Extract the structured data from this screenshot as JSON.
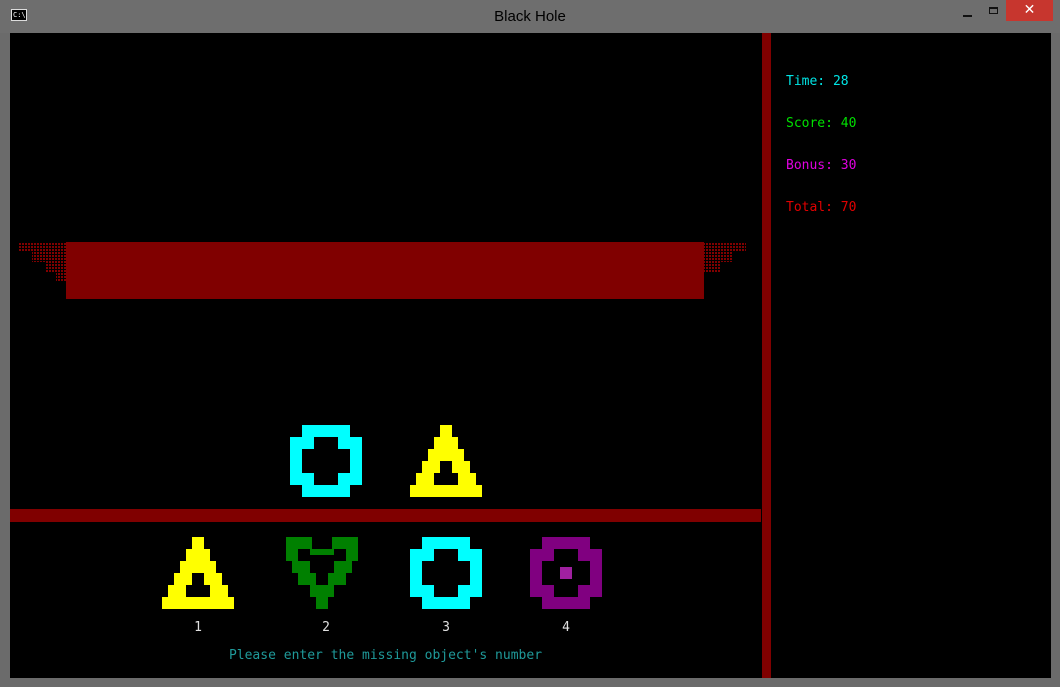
{
  "window": {
    "title": "Black Hole",
    "icon": "console-icon",
    "close_glyph": "✕"
  },
  "stats": {
    "time_label": "Time: 28",
    "score_label": "Score: 40",
    "bonus_label": "Bonus: 30",
    "total_label": "Total: 70"
  },
  "sequence": [
    {
      "shape": "ring",
      "color": "#00ffff"
    },
    {
      "shape": "triangle",
      "color": "#ffff00"
    }
  ],
  "options": [
    {
      "number": "1",
      "shape": "triangle",
      "color": "#ffff00"
    },
    {
      "number": "2",
      "shape": "heart",
      "color": "#008000"
    },
    {
      "number": "3",
      "shape": "ring",
      "color": "#00ffff"
    },
    {
      "number": "4",
      "shape": "square-ring",
      "color": "#800080"
    }
  ],
  "prompt": "Please enter the missing object's number",
  "colors": {
    "hole": "#800000",
    "divider": "#800000",
    "prompt": "#1f9a9a"
  }
}
